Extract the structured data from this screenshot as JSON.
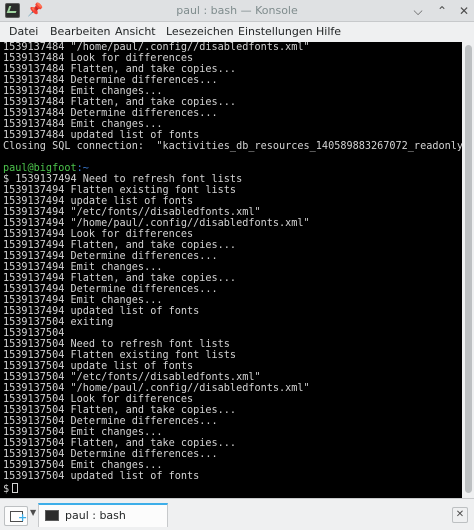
{
  "window": {
    "title": "paul : bash — Konsole"
  },
  "menu": [
    "Datei",
    "Bearbeiten",
    "Ansicht",
    "Lesezeichen",
    "Einstellungen",
    "Hilfe"
  ],
  "terminal": {
    "lines": [
      "1539137484 \"/home/paul/.config//disabledfonts.xml\"",
      "1539137484 Look for differences",
      "1539137484 Flatten, and take copies...",
      "1539137484 Determine differences...",
      "1539137484 Emit changes...",
      "1539137484 Flatten, and take copies...",
      "1539137484 Determine differences...",
      "1539137484 Emit changes...",
      "1539137484 updated list of fonts",
      "Closing SQL connection:  \"kactivities_db_resources_140589883267072_readonly\"",
      "",
      "",
      "$ 1539137494 Need to refresh font lists",
      "1539137494 Flatten existing font lists",
      "1539137494 update list of fonts",
      "1539137494 \"/etc/fonts//disabledfonts.xml\"",
      "1539137494 \"/home/paul/.config//disabledfonts.xml\"",
      "1539137494 Look for differences",
      "1539137494 Flatten, and take copies...",
      "1539137494 Determine differences...",
      "1539137494 Emit changes...",
      "1539137494 Flatten, and take copies...",
      "1539137494 Determine differences...",
      "1539137494 Emit changes...",
      "1539137494 updated list of fonts",
      "1539137504 exiting",
      "1539137504",
      "1539137504 Need to refresh font lists",
      "1539137504 Flatten existing font lists",
      "1539137504 update list of fonts",
      "1539137504 \"/etc/fonts//disabledfonts.xml\"",
      "1539137504 \"/home/paul/.config//disabledfonts.xml\"",
      "1539137504 Look for differences",
      "1539137504 Flatten, and take copies...",
      "1539137504 Determine differences...",
      "1539137504 Emit changes...",
      "1539137504 Flatten, and take copies...",
      "1539137504 Determine differences...",
      "1539137504 Emit changes...",
      "1539137504 updated list of fonts"
    ],
    "prompt_user": "paul@bigfoot",
    "prompt_path": ":~",
    "current_prompt": "$"
  },
  "tabs": [
    {
      "label": "paul : bash"
    }
  ]
}
